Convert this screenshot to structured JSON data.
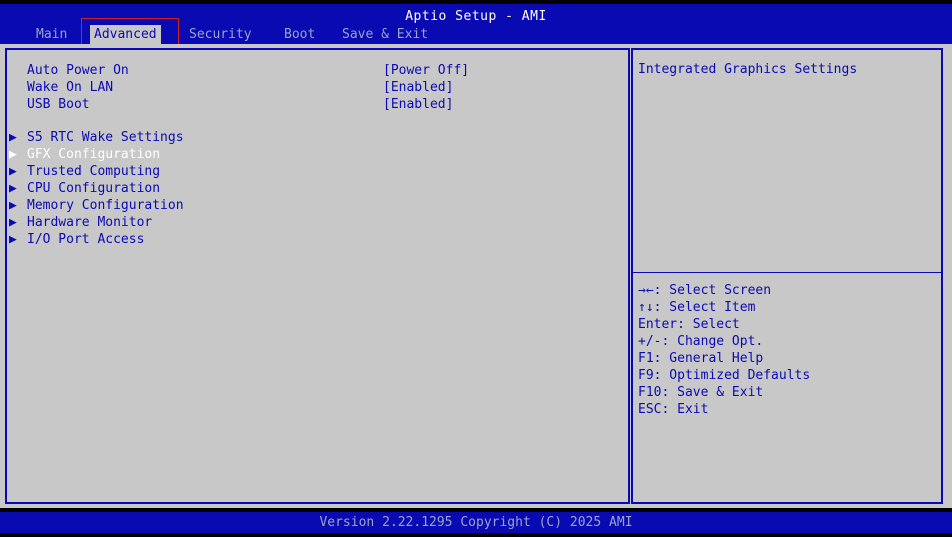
{
  "header": {
    "title": "Aptio Setup - AMI",
    "tabs": [
      {
        "label": "Main"
      },
      {
        "label": "Advanced"
      },
      {
        "label": "Security"
      },
      {
        "label": "Boot"
      },
      {
        "label": "Save & Exit"
      }
    ],
    "active_tab": "Advanced"
  },
  "settings": [
    {
      "label": "Auto Power On",
      "value": "[Power Off]"
    },
    {
      "label": "Wake On LAN",
      "value": "[Enabled]"
    },
    {
      "label": "USB Boot",
      "value": "[Enabled]"
    }
  ],
  "submenus": [
    {
      "label": "S5 RTC Wake Settings"
    },
    {
      "label": "GFX Configuration",
      "selected": true
    },
    {
      "label": "Trusted Computing"
    },
    {
      "label": "CPU Configuration"
    },
    {
      "label": "Memory Configuration"
    },
    {
      "label": "Hardware Monitor"
    },
    {
      "label": "I/O Port Access"
    }
  ],
  "help": {
    "description": "Integrated Graphics Settings",
    "keys": [
      "→←: Select Screen",
      "↑↓: Select Item",
      "Enter: Select",
      "+/-: Change Opt.",
      "F1: General Help",
      "F9: Optimized Defaults",
      "F10: Save & Exit",
      "ESC: Exit"
    ]
  },
  "footer": {
    "version": "Version 2.22.1295 Copyright (C) 2025 AMI"
  },
  "colors": {
    "bios_blue": "#0a0ab2",
    "panel_gray": "#c8c8c8",
    "selected_text": "#ffffff",
    "dim_text": "#9aa4c8",
    "highlight_outline": "#d02020"
  },
  "icons": {
    "submenu_arrow": "triangle-right-icon"
  }
}
